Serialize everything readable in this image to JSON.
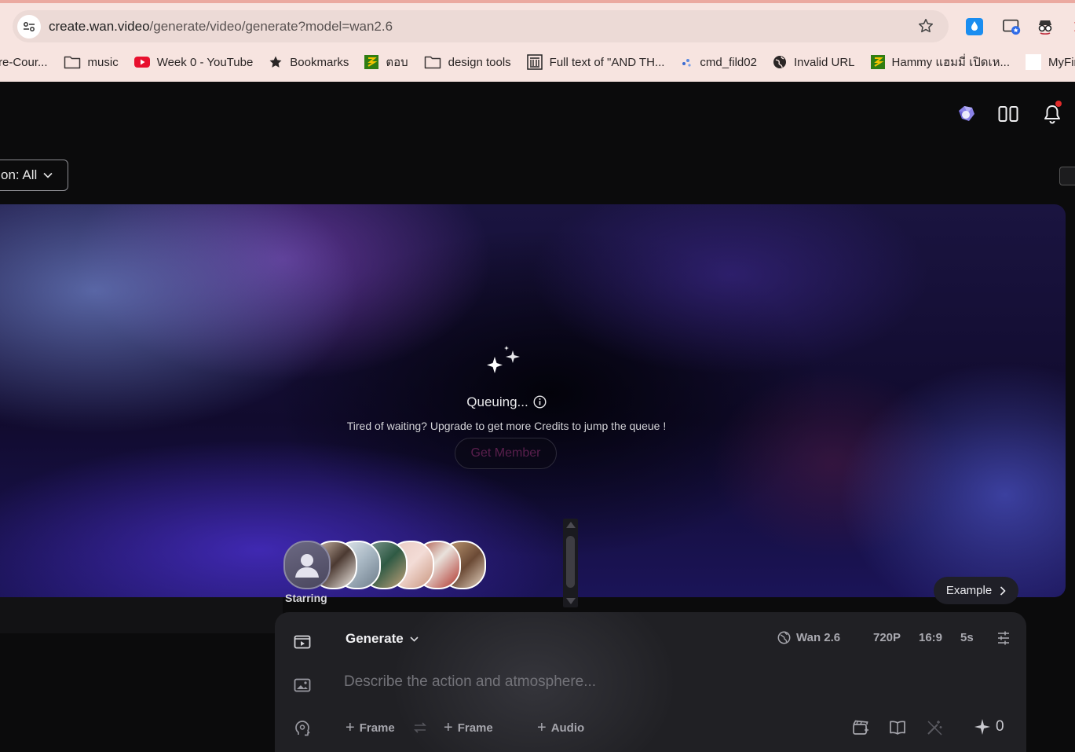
{
  "browser": {
    "url_host": "create.wan.video",
    "url_path": "/generate/video/generate?model=wan2.6",
    "bookmarks": [
      {
        "label": "re-Cour...",
        "icon": "none"
      },
      {
        "label": "music",
        "icon": "folder-icon"
      },
      {
        "label": "Week 0 - YouTube",
        "icon": "youtube-icon"
      },
      {
        "label": "Bookmarks",
        "icon": "star-icon"
      },
      {
        "label": "ตอบ",
        "icon": "site-icon"
      },
      {
        "label": "design tools",
        "icon": "folder-icon"
      },
      {
        "label": "Full text of \"AND TH...",
        "icon": "archive-icon"
      },
      {
        "label": "cmd_fild02",
        "icon": "site-icon"
      },
      {
        "label": "Invalid URL",
        "icon": "globe-icon"
      },
      {
        "label": "Hammy แฮมมี่ เปิดเห...",
        "icon": "site-icon"
      },
      {
        "label": "MyFirs",
        "icon": "page-icon"
      }
    ]
  },
  "filter": {
    "label": "on: All"
  },
  "status": {
    "title": "Queuing...",
    "tip": "Tired of waiting? Upgrade to get more Credits to jump the queue !",
    "member_button": "Get Member"
  },
  "starring": {
    "label": "Starring"
  },
  "example": {
    "label": "Example"
  },
  "composer": {
    "mode": "Generate",
    "model": "Wan 2.6",
    "resolution": "720P",
    "aspect": "16:9",
    "duration": "5s",
    "placeholder": "Describe the action and atmosphere...",
    "frame_start": "Frame",
    "frame_end": "Frame",
    "audio": "Audio",
    "credits": "0"
  },
  "colors": {
    "accent_red": "#e12b2b",
    "app_bg": "#0b0b0c",
    "composer_bg": "#202024"
  }
}
